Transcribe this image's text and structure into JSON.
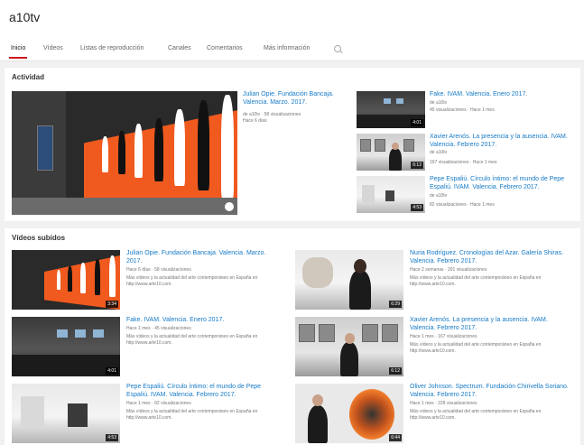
{
  "channel": {
    "name": "a10tv"
  },
  "tabs": [
    {
      "label": "Inicio",
      "active": true
    },
    {
      "label": "Vídeos"
    },
    {
      "label": "Listas de reproducción"
    },
    {
      "label": "Canales"
    },
    {
      "label": "Comentarios"
    },
    {
      "label": "Más información"
    }
  ],
  "search_icon": "search-icon",
  "activity": {
    "title": "Actividad",
    "featured": {
      "title": "Julian Opie. Fundación Bancaja. Valencia. Marzo. 2017.",
      "meta1": "de a10tv · 58 visualizaciones",
      "meta2": "Hace 6 días"
    },
    "side": [
      {
        "title": "Fake. IVAM. Valencia. Enero 2017.",
        "by": "de a10tv",
        "meta": "45 visualizaciones · Hace 1 mes",
        "duration": "4:01"
      },
      {
        "title": "Xavier Arenós. La presencia y la ausencia. IVAM. Valencia. Febrero 2017.",
        "by": "de a10tv",
        "meta": "167 visualizaciones · Hace 1 mes",
        "duration": "6:12"
      },
      {
        "title": "Pepe Espaliú. Círculo íntimo: el mundo de Pepe Espaliú. IVAM. Valencia. Febrero 2017.",
        "by": "de a10tv",
        "meta": "82 visualizaciones · Hace 1 mes",
        "duration": "4:53"
      }
    ]
  },
  "uploads": {
    "title": "Vídeos subidos",
    "items": [
      {
        "title": "Julian Opie. Fundación Bancaja. Valencia. Marzo. 2017.",
        "meta": "Hace 6 días · 58 visualizaciones",
        "desc": "Más vídeos y la actualidad del arte contemporáneo en España en http://www.arte10.com.",
        "duration": "3:34"
      },
      {
        "title": "Nuria Rodríguez. Cronologías del Azar. Galería Shiras. Valencia. Febrero 2017.",
        "meta": "Hace 2 semanas · 291 visualizaciones",
        "desc": "Más vídeos y la actualidad del arte contemporáneo en España en http://www.arte10.com.",
        "duration": "6:29"
      },
      {
        "title": "Fake. IVAM. Valencia. Enero 2017.",
        "meta": "Hace 1 mes · 45 visualizaciones",
        "desc": "Más vídeos y la actualidad del arte contemporáneo en España en http://www.arte10.com.",
        "duration": "4:01"
      },
      {
        "title": "Xavier Arenós. La presencia y la ausencia. IVAM. Valencia. Febrero 2017.",
        "meta": "Hace 1 mes · 167 visualizaciones",
        "desc": "Más vídeos y la actualidad del arte contemporáneo en España en http://www.arte10.com.",
        "duration": "6:12"
      },
      {
        "title": "Pepe Espaliú. Círculo íntimo: el mundo de Pepe Espaliú. IVAM. Valencia. Febrero 2017.",
        "meta": "Hace 1 mes · 82 visualizaciones",
        "desc": "Más vídeos y la actualidad del arte contemporáneo en España en http://www.arte10.com.",
        "duration": "4:53"
      },
      {
        "title": "Oliver Johnson. Spectrum. Fundación Chirivella Soriano. Valencia. Febrero 2017.",
        "meta": "Hace 1 mes · 228 visualizaciones",
        "desc": "Más vídeos y la actualidad del arte contemporáneo en España en http://www.arte10.com.",
        "duration": "6:44"
      }
    ]
  },
  "colors": {
    "link": "#167ac6",
    "accent": "#cc181e",
    "meta": "#767676"
  }
}
